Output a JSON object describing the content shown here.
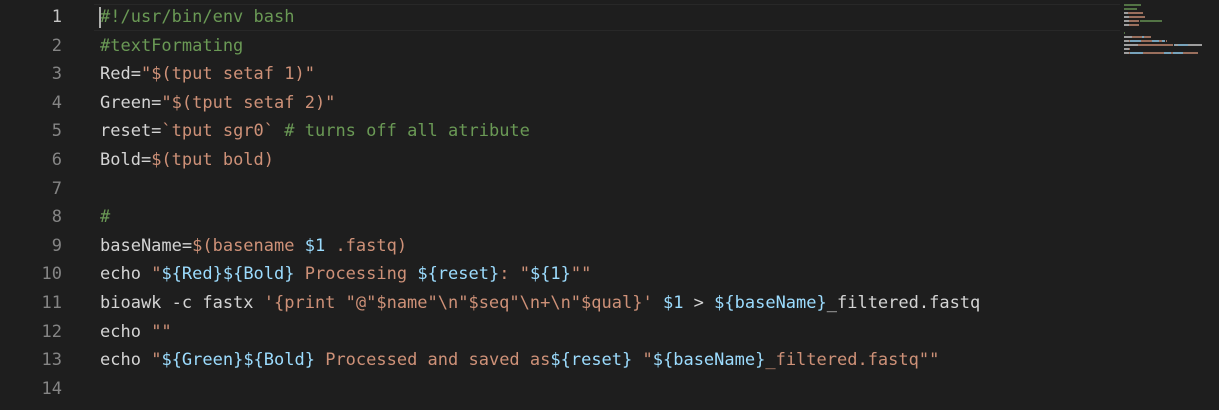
{
  "editor": {
    "language": "shellscript",
    "active_line": 1,
    "lines": [
      {
        "number": "1",
        "tokens": [
          {
            "t": "#!/usr/bin/env bash",
            "c": "comment"
          }
        ]
      },
      {
        "number": "2",
        "tokens": [
          {
            "t": "#textFormating",
            "c": "comment"
          }
        ]
      },
      {
        "number": "3",
        "tokens": [
          {
            "t": "Red=",
            "c": "plain"
          },
          {
            "t": "\"$(tput setaf 1)\"",
            "c": "string"
          }
        ]
      },
      {
        "number": "4",
        "tokens": [
          {
            "t": "Green=",
            "c": "plain"
          },
          {
            "t": "\"$(tput setaf 2)\"",
            "c": "string"
          }
        ]
      },
      {
        "number": "5",
        "tokens": [
          {
            "t": "reset=",
            "c": "plain"
          },
          {
            "t": "`tput sgr0`",
            "c": "string"
          },
          {
            "t": " ",
            "c": "plain"
          },
          {
            "t": "# turns off all atribute",
            "c": "comment"
          }
        ]
      },
      {
        "number": "6",
        "tokens": [
          {
            "t": "Bold=",
            "c": "plain"
          },
          {
            "t": "$(tput bold)",
            "c": "string"
          }
        ]
      },
      {
        "number": "7",
        "tokens": []
      },
      {
        "number": "8",
        "tokens": [
          {
            "t": "#",
            "c": "comment"
          }
        ]
      },
      {
        "number": "9",
        "tokens": [
          {
            "t": "baseName=",
            "c": "plain"
          },
          {
            "t": "$(basename ",
            "c": "string"
          },
          {
            "t": "$1",
            "c": "var"
          },
          {
            "t": " .fastq)",
            "c": "string"
          }
        ]
      },
      {
        "number": "10",
        "tokens": [
          {
            "t": "echo ",
            "c": "plain"
          },
          {
            "t": "\"",
            "c": "string"
          },
          {
            "t": "${Red}${Bold}",
            "c": "var"
          },
          {
            "t": " Processing ",
            "c": "string"
          },
          {
            "t": "${reset}",
            "c": "var"
          },
          {
            "t": ": \"",
            "c": "string"
          },
          {
            "t": "${1}",
            "c": "var"
          },
          {
            "t": "\"\"",
            "c": "string"
          }
        ]
      },
      {
        "number": "11",
        "tokens": [
          {
            "t": "bioawk -c fastx ",
            "c": "plain"
          },
          {
            "t": "'{print \"@\"$name\"\\n\"$seq\"\\n+\\n\"$qual}'",
            "c": "string"
          },
          {
            "t": " ",
            "c": "plain"
          },
          {
            "t": "$1",
            "c": "var"
          },
          {
            "t": " > ",
            "c": "plain"
          },
          {
            "t": "${baseName}",
            "c": "var"
          },
          {
            "t": "_filtered.fastq",
            "c": "plain"
          }
        ]
      },
      {
        "number": "12",
        "tokens": [
          {
            "t": "echo ",
            "c": "plain"
          },
          {
            "t": "\"\"",
            "c": "string"
          }
        ]
      },
      {
        "number": "13",
        "tokens": [
          {
            "t": "echo ",
            "c": "plain"
          },
          {
            "t": "\"",
            "c": "string"
          },
          {
            "t": "${Green}${Bold}",
            "c": "var"
          },
          {
            "t": " Processed and saved as",
            "c": "string"
          },
          {
            "t": "${reset}",
            "c": "var"
          },
          {
            "t": " \"",
            "c": "string"
          },
          {
            "t": "${baseName}",
            "c": "var"
          },
          {
            "t": "_filtered.fastq\"\"",
            "c": "string"
          }
        ]
      },
      {
        "number": "14",
        "tokens": []
      }
    ]
  },
  "colors": {
    "background": "#1e1e1e",
    "comment": "#6a9955",
    "string": "#ce9178",
    "variable": "#9cdcfe",
    "plain": "#d4d4d4",
    "line_number": "#858585",
    "line_number_active": "#c6c6c6"
  }
}
